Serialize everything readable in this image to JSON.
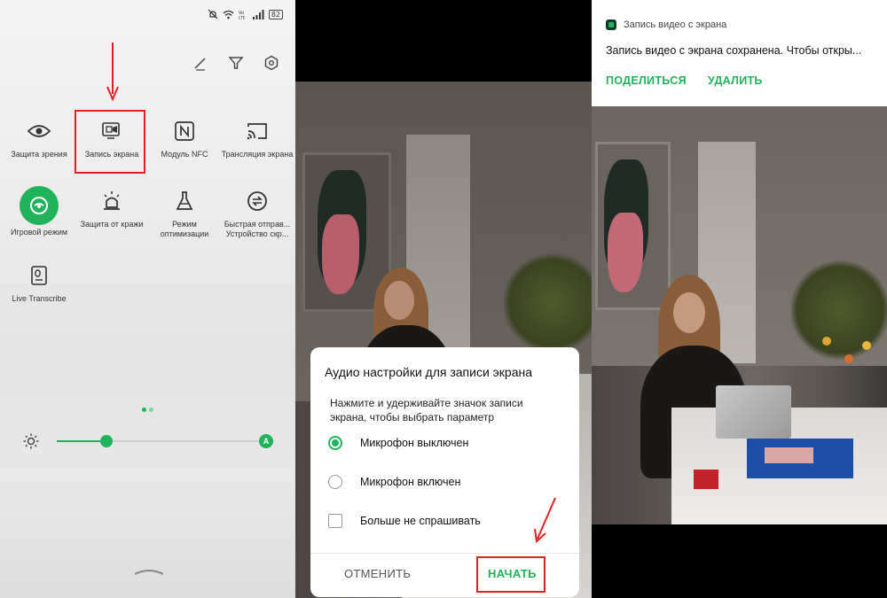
{
  "quick_settings": {
    "status": {
      "battery": "82"
    },
    "tiles": [
      {
        "id": "eye",
        "label": "Защита зрения"
      },
      {
        "id": "screen-record",
        "label": "Запись экрана"
      },
      {
        "id": "nfc",
        "label": "Модуль NFC"
      },
      {
        "id": "cast",
        "label": "Трансляция экрана"
      },
      {
        "id": "game",
        "label": "Игровой режим"
      },
      {
        "id": "theft",
        "label": "Защита от кражи"
      },
      {
        "id": "optimize",
        "label": "Режим оптимизации"
      },
      {
        "id": "quick-send",
        "label": "Быстрая отправ... Устройство скр..."
      },
      {
        "id": "live-transcribe",
        "label": "Live Transcribe"
      }
    ],
    "brightness": {
      "level": 0.24,
      "auto_label": "A"
    },
    "accent_color": "#21b35b"
  },
  "dialog": {
    "title": "Аудио настройки для записи экрана",
    "description": "Нажмите и удерживайте значок записи экрана, чтобы выбрать параметр",
    "options": [
      {
        "label": "Микрофон выключен",
        "selected": true
      },
      {
        "label": "Микрофон включен",
        "selected": false
      }
    ],
    "checkbox": {
      "label": "Больше не спрашивать",
      "checked": false
    },
    "cancel_label": "ОТМЕНИТЬ",
    "start_label": "НАЧАТЬ"
  },
  "notification": {
    "app_name": "Запись видео с экрана",
    "message": "Запись видео с экрана сохранена. Чтобы откры...",
    "share_label": "ПОДЕЛИТЬСЯ",
    "delete_label": "УДАЛИТЬ"
  },
  "annotation_color": "#e02020"
}
